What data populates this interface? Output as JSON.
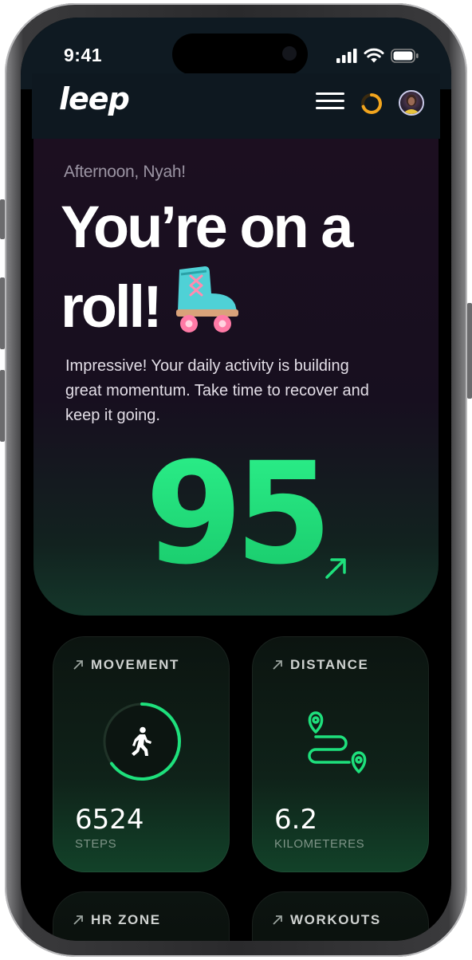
{
  "status_bar": {
    "time": "9:41",
    "icons": [
      "cellular-signal-icon",
      "wifi-icon",
      "battery-icon"
    ]
  },
  "app_bar": {
    "logo": "leep",
    "icons": [
      "menu-icon",
      "activity-ring-icon",
      "avatar"
    ]
  },
  "hero": {
    "greeting": "Afternoon, Nyah!",
    "headline_line1": "You’re on a",
    "headline_line2": "roll!",
    "emoji": "roller-skate-icon",
    "body": "Impressive! Your daily activity is building great momentum. Take time to recover and keep it going.",
    "score": "95",
    "trend": "up",
    "score_color": "#1ee07c"
  },
  "cards": [
    {
      "title": "MOVEMENT",
      "icon": "walking-person-icon",
      "value": "6524",
      "unit": "STEPS",
      "progress": 0.65
    },
    {
      "title": "DISTANCE",
      "icon": "route-icon",
      "value": "6.2",
      "unit": "KILOMETERES"
    },
    {
      "title": "HR ZONE"
    },
    {
      "title": "WORKOUTS"
    }
  ],
  "colors": {
    "accent": "#1ee07c",
    "ring": "#f2a51e",
    "background": "#000000",
    "hero_bg": "#170f1f"
  }
}
